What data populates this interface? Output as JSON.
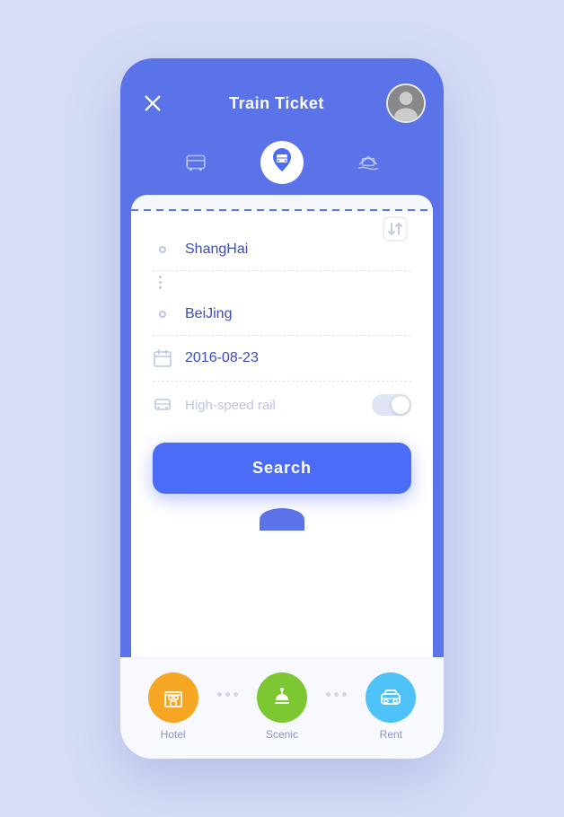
{
  "header": {
    "title": "Train Ticket",
    "close_icon": "×",
    "avatar_alt": "User avatar"
  },
  "transport_tabs": [
    {
      "id": "bus",
      "label": "Bus",
      "active": false
    },
    {
      "id": "train",
      "label": "Train",
      "active": true
    },
    {
      "id": "ferry",
      "label": "Ferry",
      "active": false
    }
  ],
  "form": {
    "from_city": "ShangHai",
    "to_city": "BeiJing",
    "date": "2016-08-23",
    "train_type_label": "High-speed rail",
    "train_type_enabled": false
  },
  "search_button_label": "Search",
  "bottom_nav": [
    {
      "id": "hotel",
      "label": "Hotel",
      "color": "#f5a623"
    },
    {
      "id": "scenic",
      "label": "Scenic",
      "color": "#7dc832"
    },
    {
      "id": "rent",
      "label": "Rent",
      "color": "#4fc3f7"
    }
  ]
}
